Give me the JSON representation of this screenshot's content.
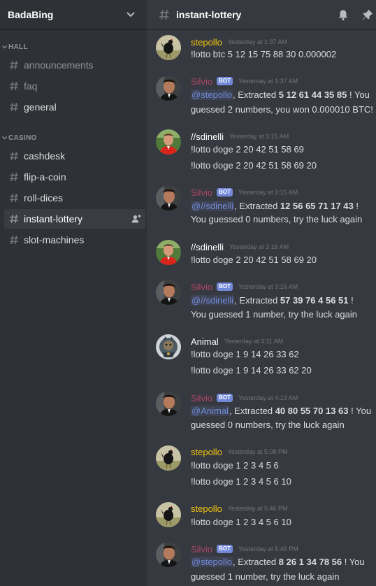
{
  "guild": {
    "name": "BadaBing"
  },
  "categories": {
    "hall": {
      "label": "HALL",
      "channels": [
        "announcements",
        "faq",
        "general"
      ]
    },
    "casino": {
      "label": "CASINO",
      "channels": [
        "cashdesk",
        "flip-a-coin",
        "roll-dices",
        "instant-lottery",
        "slot-machines"
      ]
    }
  },
  "active_channel": "instant-lottery",
  "header": {
    "channel": "instant-lottery",
    "icons": [
      "bell-icon",
      "pin-icon"
    ]
  },
  "messages": [
    {
      "author": "stepollo",
      "ts": "Yesterday at 1:37 AM",
      "lines": [
        "!lotto btc 5 12 15 75 88 30 0.000002"
      ]
    },
    {
      "author": "Silvio",
      "bot": "BOT",
      "ts": "Yesterday at 1:37 AM",
      "mention": "@stepollo",
      "pre": ", Extracted ",
      "numbers": "5 12 61 44 35 85",
      "post": " ! You",
      "line2": "guessed 2 numbers, you won 0.000010 BTC!"
    },
    {
      "author": "//sdinelli",
      "ts": "Yesterday at 3:15 AM",
      "lines": [
        "!lotto doge 2 20 42 51 58 69",
        "!lotto doge 2 20 42 51 58 69 20"
      ]
    },
    {
      "author": "Silvio",
      "bot": "BOT",
      "ts": "Yesterday at 3:15 AM",
      "mention": "@//sdinelli",
      "pre": ", Extracted ",
      "numbers": "12 56 65 71 17 43",
      "post": " !",
      "line2": "You guessed 0 numbers, try the luck again"
    },
    {
      "author": "//sdinelli",
      "ts": "Yesterday at 3:16 AM",
      "lines": [
        "!lotto doge 2 20 42 51 58 69 20"
      ]
    },
    {
      "author": "Silvio",
      "bot": "BOT",
      "ts": "Yesterday at 3:16 AM",
      "mention": "@//sdinelli",
      "pre": ", Extracted ",
      "numbers": "57 39 76 4 56 51",
      "post": " !",
      "line2": "You guessed 1 number, try the luck again"
    },
    {
      "author": "Animal",
      "ts": "Yesterday at 4:11 AM",
      "lines": [
        "!lotto doge 1 9 14 26 33 62",
        "!lotto doge 1 9 14 26 33 62 20"
      ]
    },
    {
      "author": "Silvio",
      "bot": "BOT",
      "ts": "Yesterday at 4:13 AM",
      "mention": "@Animal",
      "pre": ", Extracted ",
      "numbers": "40 80 55 70 13 63",
      "post": " ! You",
      "line2": "guessed 0 numbers, try the luck again"
    },
    {
      "author": "stepollo",
      "ts": "Yesterday at 5:08 PM",
      "lines": [
        "!lotto doge 1 2 3 4 5 6",
        "!lotto doge 1 2 3 4 5 6 10"
      ]
    },
    {
      "author": "stepollo",
      "ts": "Yesterday at 5:46 PM",
      "lines": [
        "!lotto doge 1 2 3 4 5 6 10"
      ]
    },
    {
      "author": "Silvio",
      "bot": "BOT",
      "ts": "Yesterday at 5:46 PM",
      "mention": "@stepollo",
      "pre": ", Extracted ",
      "numbers": "8 26 1 34 78 56",
      "post": " ! You",
      "line2": "guessed 1 number, try the luck again"
    }
  ],
  "colors": {
    "sidebar": "#2f3136",
    "main": "#36393f",
    "bot_tag": "#7289da",
    "yellow_name": "#f1c40f",
    "bot_name": "#c0496e",
    "mention": "#7289da"
  }
}
